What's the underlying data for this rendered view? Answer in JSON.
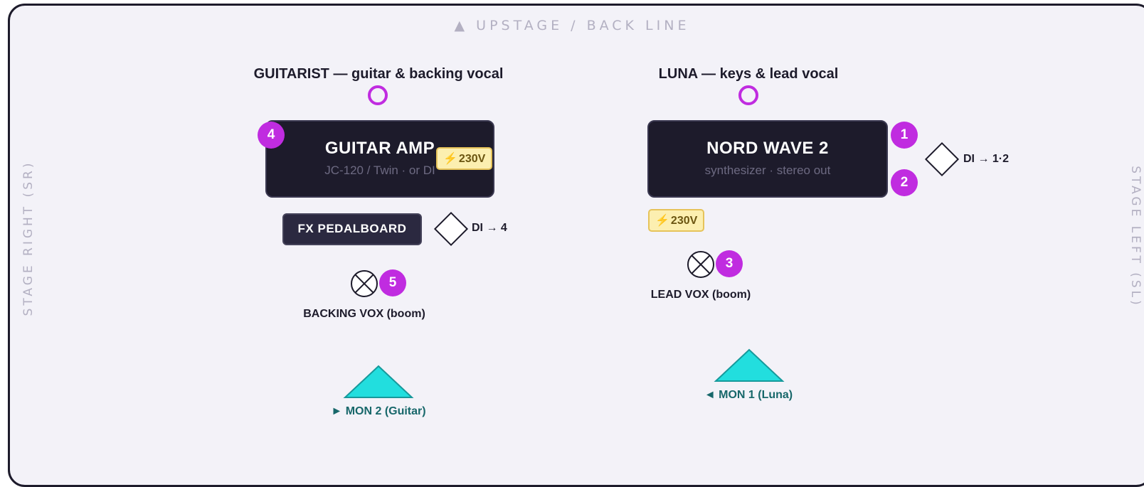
{
  "stage": {
    "upstage_label": "▲ UPSTAGE / BACK LINE",
    "stage_right_label": "STAGE RIGHT (SR)",
    "stage_left_label": "STAGE LEFT (SL)"
  },
  "guitarist": {
    "title": "GUITARIST — guitar & backing vocal",
    "amp": {
      "title": "GUITAR AMP",
      "subtitle": "JC-120 / Twin · or DI",
      "channel": "4",
      "power": "230V"
    },
    "pedalboard": {
      "label": "FX PEDALBOARD",
      "di_label": "DI → 4"
    },
    "mic": {
      "channel": "5",
      "label": "BACKING VOX (boom)"
    },
    "monitor": {
      "label": "► MON 2 (Guitar)"
    }
  },
  "luna": {
    "title": "LUNA — keys & lead vocal",
    "keys": {
      "title": "NORD WAVE 2",
      "subtitle": "synthesizer · stereo out",
      "channel_left": "1",
      "channel_right": "2",
      "di_label": "DI → 1·2",
      "power": "230V"
    },
    "mic": {
      "channel": "3",
      "label": "LEAD VOX (boom)"
    },
    "monitor": {
      "label": "◄ MON 1 (Luna)"
    }
  },
  "colors": {
    "channel_badge": "#c02ce0",
    "box": "#1d1b2b",
    "power_fill": "#fcefb0",
    "monitor": "#22dede",
    "stage_bg": "#f3f2f8"
  },
  "icons": {
    "performer": "performer-ring-icon",
    "di": "di-box-diamond-icon",
    "mic": "microphone-cross-icon",
    "monitor": "wedge-monitor-triangle-icon",
    "power": "lightning-bolt-icon"
  }
}
